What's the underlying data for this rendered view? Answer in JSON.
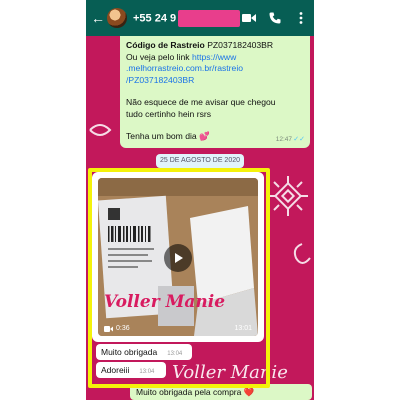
{
  "header": {
    "back_icon": "arrow-left-icon",
    "contact_prefix": "+55 24 9",
    "icons": [
      "video-call-icon",
      "phone-icon",
      "more-vertical-icon"
    ],
    "bar_color": "#075e54",
    "redaction_color": "#e83e8c"
  },
  "messages": {
    "tracking": {
      "code_label": "Código de Rastreio",
      "code_value": "PZ037182403BR",
      "link_intro": "Ou veja pelo link",
      "link_line1": "https://www",
      "link_line2": ".melhorrastreio.com.br/rastreio",
      "link_line3": "/PZ037182403BR",
      "body1": "Não esquece de me avisar que chegou",
      "body2": "tudo certinho hein rsrs",
      "closing": "Tenha um bom dia",
      "closing_emoji": "💕",
      "time": "12:47",
      "ticks": "✓✓"
    },
    "date_separator": "25 DE AGOSTO DE 2020",
    "video": {
      "duration": "0:36",
      "time": "13:01",
      "watermark": "Voller Manie"
    },
    "reply1": {
      "text": "Muito obrigada",
      "time": "13:04"
    },
    "reply2": {
      "text": "Adoreiii",
      "time": "13:04"
    },
    "last": {
      "text": "Muito obrigada pela compra",
      "emoji": "❤️"
    }
  },
  "overlay_watermark": "Voller Manie",
  "colors": {
    "wallpaper": "#c2185b",
    "outgoing_bubble": "#dcf8c6",
    "incoming_bubble": "#ffffff",
    "highlight_border": "#f4f20a",
    "link": "#1a73e8"
  }
}
